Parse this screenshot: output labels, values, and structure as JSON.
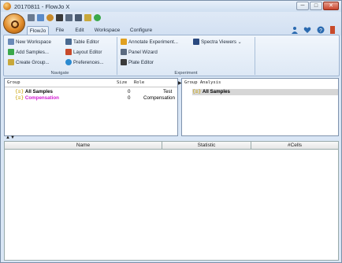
{
  "window": {
    "title": "20170811 - FlowJo X",
    "minimize_glyph": "─",
    "maximize_glyph": "□",
    "close_glyph": "✕"
  },
  "ribbon_tabs": [
    "FlowJo",
    "File",
    "Edit",
    "Workspace",
    "Configure"
  ],
  "navigate_group": {
    "label": "Navigate",
    "col1": [
      "New Workspace",
      "Add Samples...",
      "Create Group..."
    ],
    "col2": [
      "Table Editor",
      "Layout Editor",
      "Preferences..."
    ]
  },
  "experiment_group": {
    "label": "Experiment",
    "col1": [
      "Annotate Experiment...",
      "Panel Wizard",
      "Plate Editor"
    ],
    "spectra": "Spectra Viewers"
  },
  "left_panel": {
    "headers": {
      "group": "Group",
      "size": "Size",
      "role": "Role"
    },
    "rows": [
      {
        "icon": "{≡}",
        "name": "All Samples",
        "size": "0",
        "role": "Test",
        "color": "#000000"
      },
      {
        "icon": "{≡}",
        "name": "Compensation",
        "size": "0",
        "role": "Compensation",
        "color": "#d21ad2"
      }
    ]
  },
  "right_panel": {
    "header": "Group Analysis",
    "rows": [
      {
        "icon": "{≡}",
        "name": "All Samples"
      }
    ]
  },
  "table": {
    "columns": [
      "Name",
      "Statistic",
      "#Cells"
    ]
  },
  "colors": {
    "accent": "#d21ad2",
    "ribbon_bg": "#dde8f5"
  }
}
